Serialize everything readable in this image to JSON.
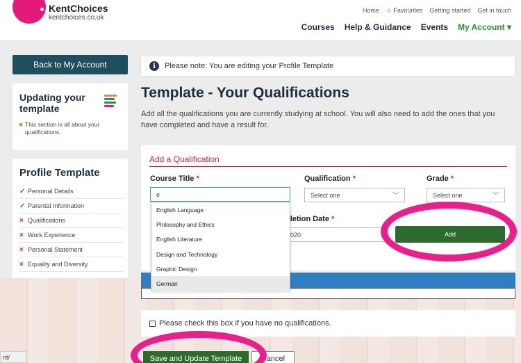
{
  "brand": {
    "name": "KentChoices",
    "url": "kentchoices.co.uk",
    "color": "#e5197a"
  },
  "topnav": [
    "Home",
    "☆ Favourites",
    "Getting started",
    "Get in touch"
  ],
  "mainnav": {
    "courses": "Courses",
    "help": "Help & Guidance",
    "events": "Events",
    "account": "My Account ▾"
  },
  "sidebar": {
    "back_label": "Back to My Account",
    "updating_title": "Updating your template",
    "updating_text": "This section is all about your qualifications.",
    "profile_title": "Profile Template",
    "items": [
      {
        "mark": "✓",
        "label": "Personal Details"
      },
      {
        "mark": "✓",
        "label": "Parental Information"
      },
      {
        "mark": "×",
        "label": "Qualifications"
      },
      {
        "mark": "×",
        "label": "Work Experience"
      },
      {
        "mark": "×",
        "label": "Personal Statement"
      },
      {
        "mark": "×",
        "label": "Equality and Diversity"
      }
    ]
  },
  "note": {
    "icon": "i",
    "text": "Please note: You are editing your Profile Template"
  },
  "main": {
    "title": "Template - Your Qualifications",
    "intro": "Add all the qualifications you are currently studying at school. You will also need to add the ones that you have completed and have a result for."
  },
  "form": {
    "heading": "Add a Qualification",
    "course_label": "Course Title",
    "course_value": "e",
    "qualification_label": "Qualification",
    "qualification_value": "Select one",
    "grade_label": "Grade",
    "grade_value": "Select one",
    "completion_label": "pletion Date",
    "completion_value": "2020",
    "required_mark": "*",
    "add_label": "Add"
  },
  "dropdown": [
    "English Language",
    "Philosophy and Ethics",
    "English Literature",
    "Design and Technology",
    "Graphic Design",
    "German"
  ],
  "no_quals_label": "Please check this box if you have no qualifications.",
  "actions": {
    "save": "Save and Update Template",
    "cancel": "Cancel"
  },
  "status_url": "nt/",
  "colors": {
    "accent_green": "#2c6a2e",
    "highlight_ring": "#ea1f8c",
    "nav_teal": "#1f4e5c"
  }
}
